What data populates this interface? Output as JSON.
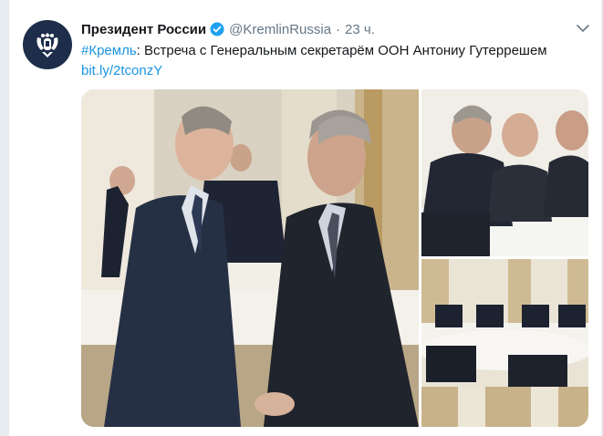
{
  "tweet": {
    "author_name": "Президент России",
    "handle": "@KremlinRussia",
    "separator": "·",
    "time": "23 ч.",
    "hashtag": "#Кремль",
    "text": ": Встреча с Генеральным секретарём ООН Антониу Гутеррешем",
    "link": "bit.ly/2tconzY"
  },
  "colors": {
    "link": "#1b95e0",
    "verified": "#1da1f2",
    "secondary_text": "#657786",
    "primary_text": "#14171a"
  },
  "icons": {
    "avatar": "coat-of-arms-icon",
    "verified": "verified-badge-icon",
    "menu": "chevron-down-icon"
  },
  "media": {
    "photos": [
      {
        "name": "handshake-photo"
      },
      {
        "name": "meeting-closeup-photo"
      },
      {
        "name": "meeting-table-photo"
      }
    ]
  }
}
